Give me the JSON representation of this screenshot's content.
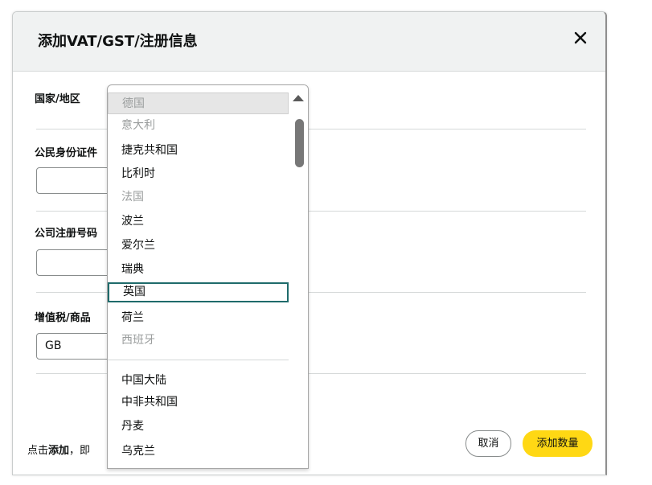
{
  "dialog": {
    "title": "添加VAT/GST/注册信息",
    "fields": {
      "country_label": "国家/地区",
      "national_id_label": "公民身份证件",
      "company_reg_label": "公司注册号码",
      "vat_label": "增值税/商品",
      "vat_value": "GB"
    },
    "footer": {
      "prefix": "点击",
      "bold": "添加",
      "suffix": "，即"
    },
    "buttons": {
      "cancel": "取消",
      "add": "添加数量"
    }
  },
  "dropdown": {
    "options": [
      {
        "label": "德国",
        "disabled": true,
        "selected": true
      },
      {
        "label": "意大利",
        "disabled": true
      },
      {
        "label": "捷克共和国",
        "disabled": false
      },
      {
        "label": "比利时",
        "disabled": false
      },
      {
        "label": "法国",
        "disabled": true
      },
      {
        "label": "波兰",
        "disabled": false
      },
      {
        "label": "爱尔兰",
        "disabled": false
      },
      {
        "label": "瑞典",
        "disabled": false
      },
      {
        "label": "英国",
        "disabled": false,
        "highlighted": true
      },
      {
        "label": "荷兰",
        "disabled": false
      },
      {
        "label": "西班牙",
        "disabled": true
      }
    ],
    "options_more": [
      {
        "label": "中国大陆"
      },
      {
        "label": "中非共和国"
      },
      {
        "label": "丹麦"
      },
      {
        "label": "乌克兰"
      }
    ]
  }
}
